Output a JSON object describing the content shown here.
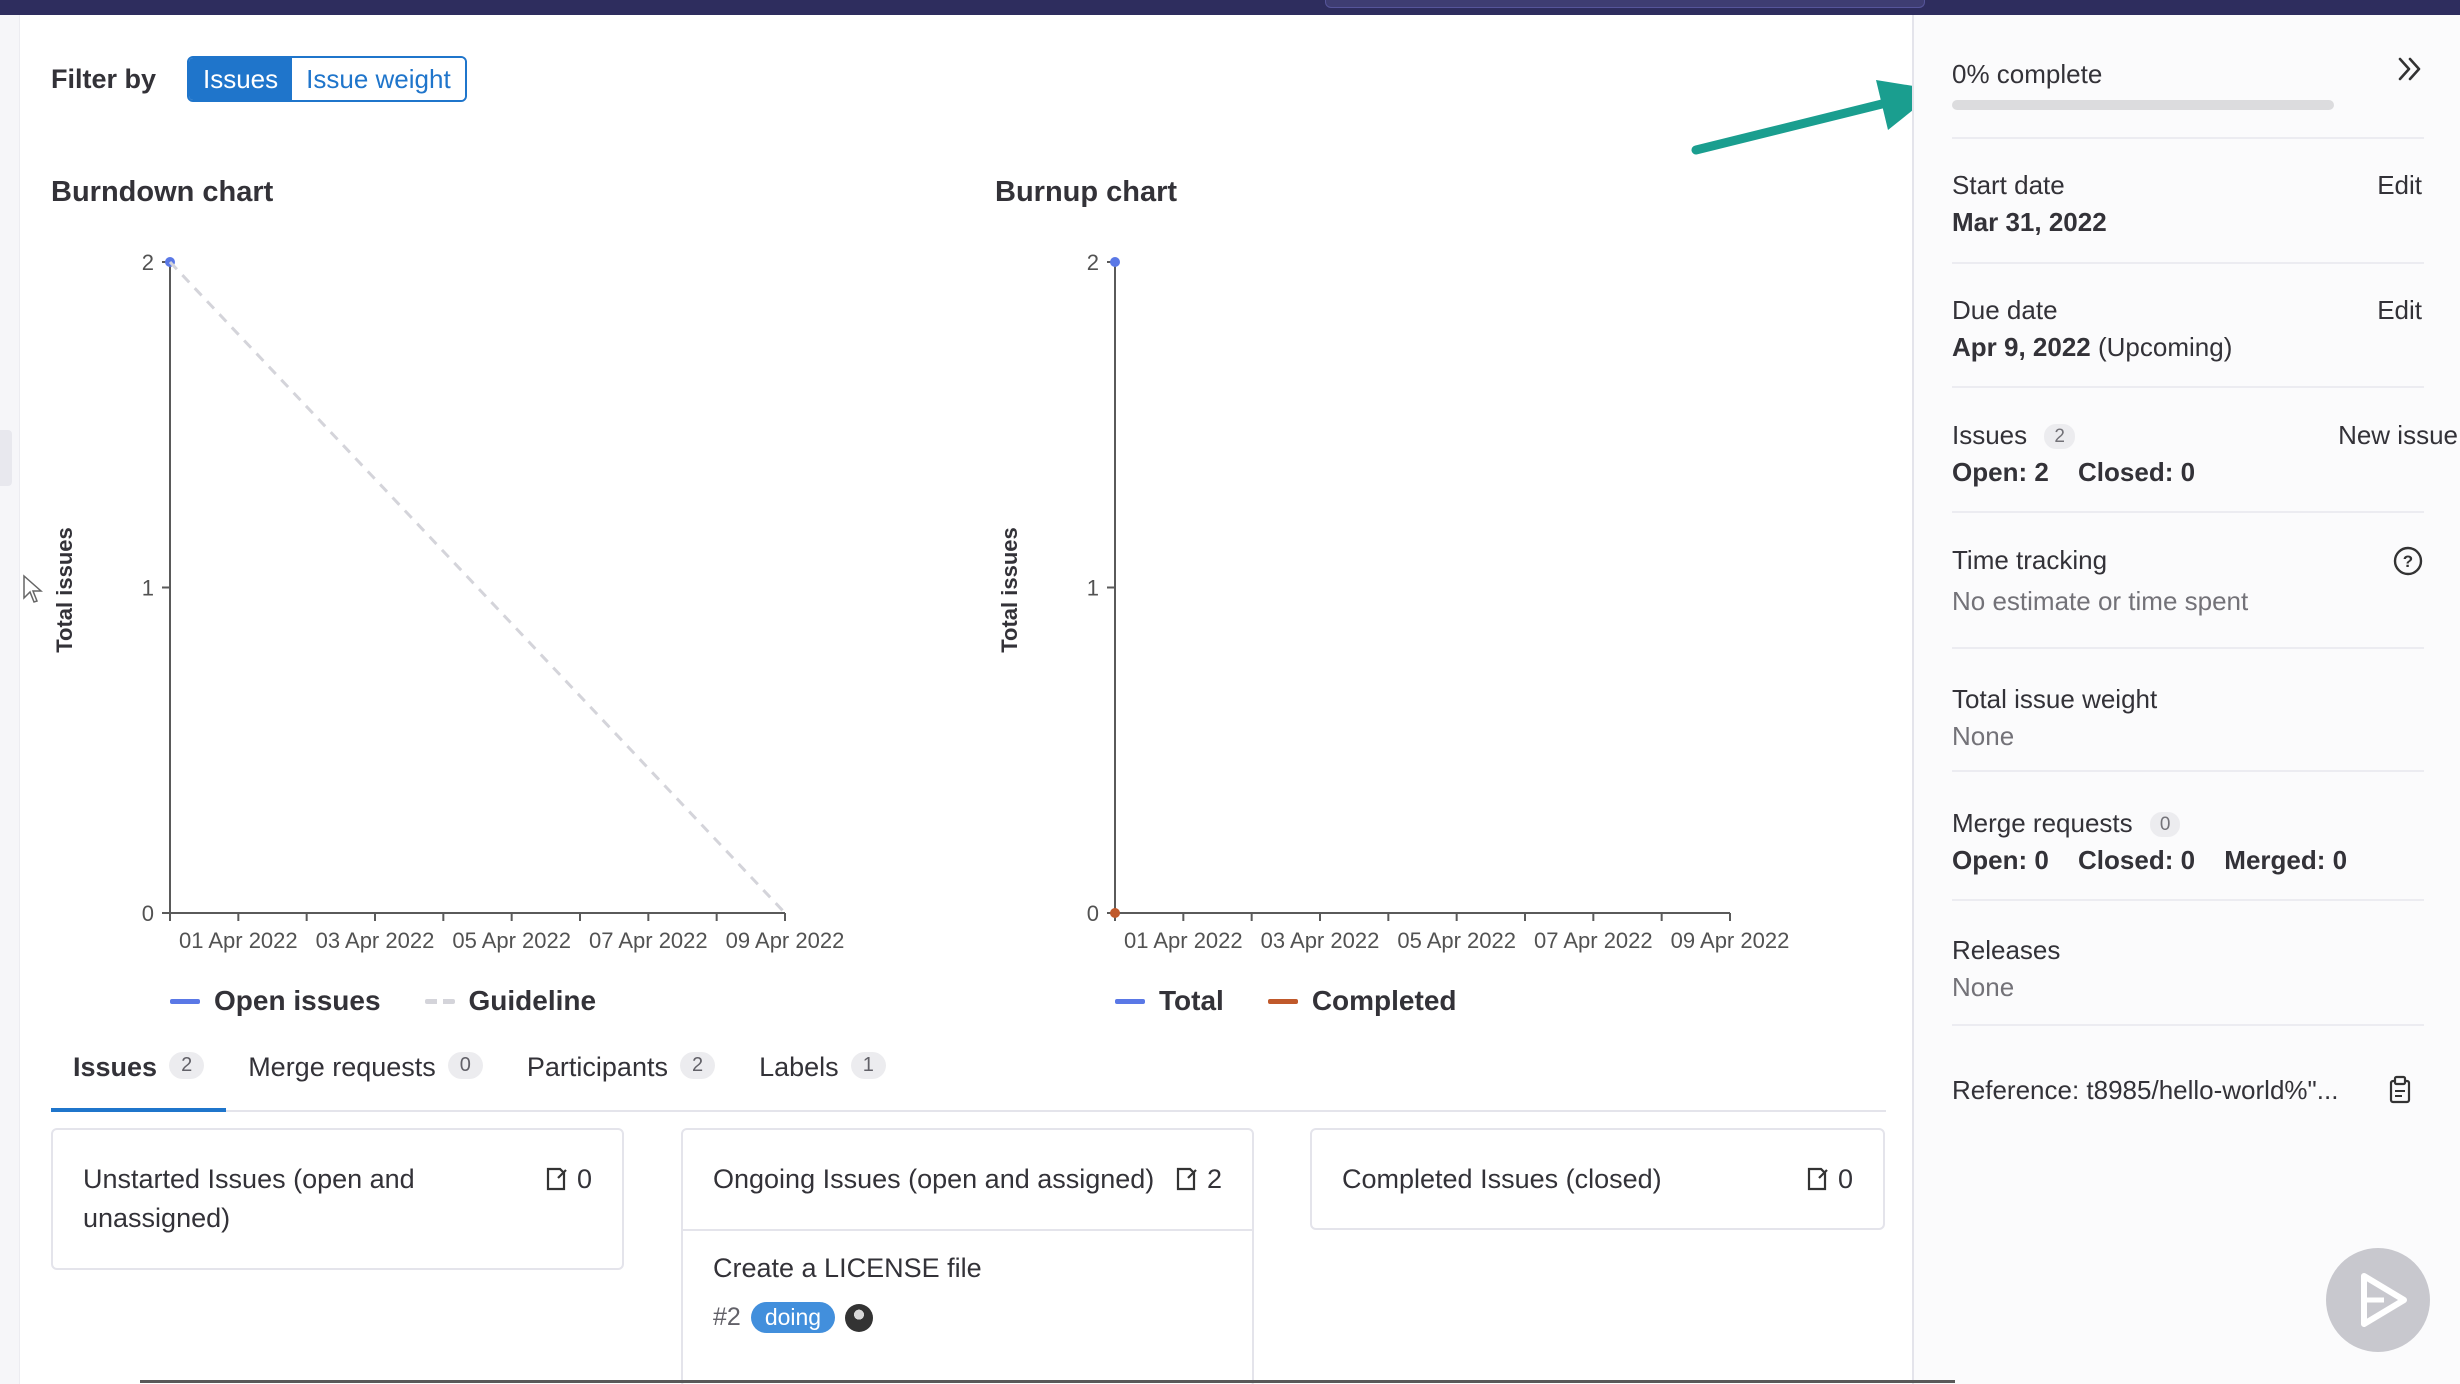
{
  "filter": {
    "label": "Filter by",
    "options": [
      "Issues",
      "Issue weight"
    ],
    "selected": "Issues"
  },
  "burndown": {
    "title": "Burndown chart",
    "ylabel": "Total issues",
    "yticks": [
      "0",
      "1",
      "2"
    ],
    "xticks": [
      "01 Apr 2022",
      "03 Apr 2022",
      "05 Apr 2022",
      "07 Apr 2022",
      "09 Apr 2022"
    ],
    "legend": [
      "Open issues",
      "Guideline"
    ]
  },
  "burnup": {
    "title": "Burnup chart",
    "ylabel": "Total issues",
    "yticks": [
      "0",
      "1",
      "2"
    ],
    "xticks": [
      "01 Apr 2022",
      "03 Apr 2022",
      "05 Apr 2022",
      "07 Apr 2022",
      "09 Apr 2022"
    ],
    "legend": [
      "Total",
      "Completed"
    ]
  },
  "chart_data": [
    {
      "type": "line",
      "title": "Burndown chart",
      "xlabel": "",
      "ylabel": "Total issues",
      "ylim": [
        0,
        2
      ],
      "xlim": [
        "2022-03-31",
        "2022-04-09"
      ],
      "series": [
        {
          "name": "Open issues",
          "x": [
            "2022-03-31"
          ],
          "y": [
            2
          ],
          "color": "#5a78e6"
        },
        {
          "name": "Guideline",
          "x": [
            "2022-03-31",
            "2022-04-09"
          ],
          "y": [
            2,
            0
          ],
          "color": "#d4d4da",
          "style": "dashed"
        }
      ]
    },
    {
      "type": "line",
      "title": "Burnup chart",
      "xlabel": "",
      "ylabel": "Total issues",
      "ylim": [
        0,
        2
      ],
      "xlim": [
        "2022-03-31",
        "2022-04-09"
      ],
      "series": [
        {
          "name": "Total",
          "x": [
            "2022-03-31"
          ],
          "y": [
            2
          ],
          "color": "#5a78e6"
        },
        {
          "name": "Completed",
          "x": [
            "2022-03-31"
          ],
          "y": [
            0
          ],
          "color": "#c0592b"
        }
      ]
    }
  ],
  "tabs": [
    {
      "label": "Issues",
      "count": "2"
    },
    {
      "label": "Merge requests",
      "count": "0"
    },
    {
      "label": "Participants",
      "count": "2"
    },
    {
      "label": "Labels",
      "count": "1"
    }
  ],
  "boards": {
    "unstarted": {
      "title": "Unstarted Issues (open and unassigned)",
      "count": "0"
    },
    "ongoing": {
      "title": "Ongoing Issues (open and assigned)",
      "count": "2",
      "issue": {
        "title": "Create a LICENSE file",
        "ref": "#2",
        "label": "doing"
      }
    },
    "completed": {
      "title": "Completed Issues (closed)",
      "count": "0"
    }
  },
  "sidebar": {
    "progress_text": "0% complete",
    "progress_value": 0,
    "start_date": {
      "label": "Start date",
      "value": "Mar 31, 2022",
      "edit": "Edit"
    },
    "due_date": {
      "label": "Due date",
      "value": "Apr 9, 2022",
      "suffix": "(Upcoming)",
      "edit": "Edit"
    },
    "issues": {
      "label": "Issues",
      "count": "2",
      "new": "New issue",
      "open": "Open: 2",
      "closed": "Closed: 0"
    },
    "time_tracking": {
      "label": "Time tracking",
      "value": "No estimate or time spent"
    },
    "weight": {
      "label": "Total issue weight",
      "value": "None"
    },
    "merge_requests": {
      "label": "Merge requests",
      "count": "0",
      "open": "Open: 0",
      "closed": "Closed: 0",
      "merged": "Merged: 0"
    },
    "releases": {
      "label": "Releases",
      "value": "None"
    },
    "reference": "Reference: t8985/hello-world%\"..."
  },
  "colors": {
    "accent": "#1f75cb",
    "open_issues": "#5a78e6",
    "guideline": "#d4d4da",
    "completed": "#c0592b",
    "annotation_arrow": "#1a9e8f"
  }
}
